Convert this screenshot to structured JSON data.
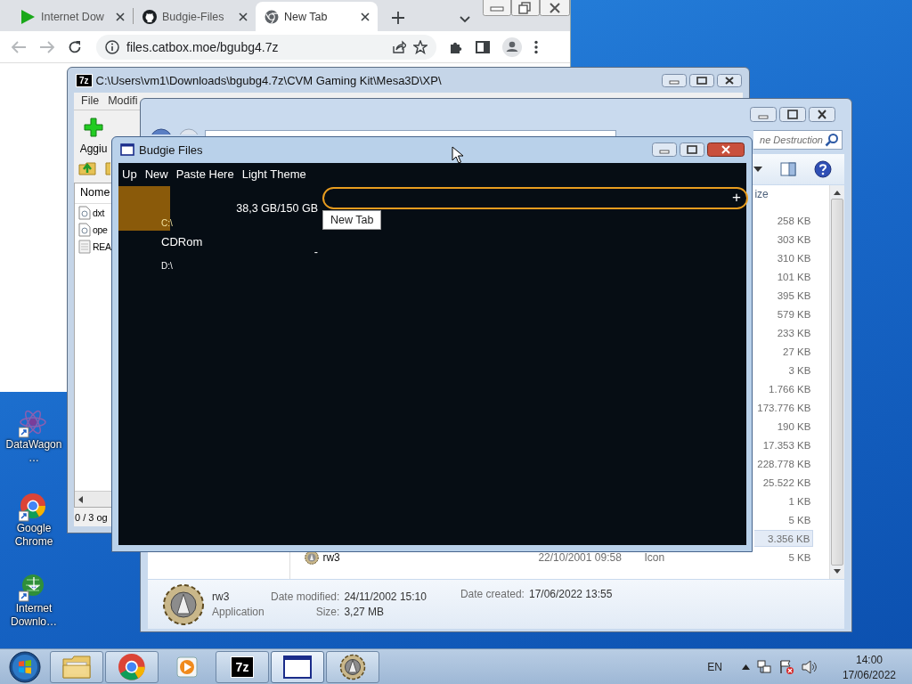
{
  "browser": {
    "tabs": [
      {
        "label": "Internet Dow",
        "kind": "download",
        "selected": false
      },
      {
        "label": "Budgie-Files",
        "kind": "github",
        "selected": false
      },
      {
        "label": "New Tab",
        "kind": "chrome",
        "selected": true
      }
    ],
    "url": "files.catbox.moe/bgubg4.7z"
  },
  "desktop_icons": [
    {
      "label": "DataWagon…",
      "kind": "atom"
    },
    {
      "label": "Google Chrome",
      "kind": "chrome"
    },
    {
      "label": "Internet Downlo…",
      "kind": "download"
    }
  ],
  "archive_window": {
    "logo": "7z",
    "title": "C:\\Users\\vm1\\Downloads\\bgubg4.7z\\CVM Gaming Kit\\Mesa3D\\XP\\",
    "menu": [
      "File",
      "Modifi"
    ],
    "add_label": "Aggiu",
    "column": "Nome",
    "files": [
      {
        "name": "dxt",
        "kind": "file"
      },
      {
        "name": "ope",
        "kind": "file"
      },
      {
        "name": "REA",
        "kind": "text"
      }
    ],
    "status": "0 / 3 og"
  },
  "explorer_window": {
    "search": {
      "placeholder": "ne Destruction"
    },
    "size_column": "ize",
    "rows": [
      {
        "size": "258 KB",
        "selected": false
      },
      {
        "size": "303 KB",
        "selected": false
      },
      {
        "size": "310 KB",
        "selected": false
      },
      {
        "size": "101 KB",
        "selected": false
      },
      {
        "size": "395 KB",
        "selected": false
      },
      {
        "size": "579 KB",
        "selected": false
      },
      {
        "size": "233 KB",
        "selected": false
      },
      {
        "size": "27 KB",
        "selected": false
      },
      {
        "size": "3 KB",
        "selected": false
      },
      {
        "size": "1.766 KB",
        "selected": false
      },
      {
        "size": "173.776 KB",
        "selected": false
      },
      {
        "size": "190 KB",
        "selected": false
      },
      {
        "size": "17.353 KB",
        "selected": false
      },
      {
        "size": "228.778 KB",
        "selected": false
      },
      {
        "size": "25.522 KB",
        "selected": false
      },
      {
        "size": "1 KB",
        "selected": false
      },
      {
        "size": "5 KB",
        "selected": false
      },
      {
        "size": "3.356 KB",
        "selected": true
      },
      {
        "name": "rw3",
        "date": "22/10/2001 09:58",
        "type": "Icon",
        "size": "5 KB",
        "kind": "gear",
        "selected": false
      }
    ],
    "details": {
      "name": "rw3",
      "type": "Application",
      "modified_label": "Date modified:",
      "modified": "24/11/2002 15:10",
      "size_label": "Size:",
      "size": "3,27 MB",
      "created_label": "Date created:",
      "created": "17/06/2022 13:55"
    }
  },
  "app_window": {
    "title": "Budgie Files",
    "menu": [
      "Up",
      "New",
      "Paste Here",
      "Light Theme"
    ],
    "drives": [
      {
        "path": "C:\\",
        "usage": "38,3 GB/150 GB",
        "selected": true
      },
      {
        "label": "CDRom",
        "path": "D:\\",
        "usage": "-",
        "selected": false
      }
    ],
    "new_tab": "+",
    "tooltip": "New Tab"
  },
  "taskbar": {
    "apps": [
      {
        "kind": "folder",
        "running": true,
        "active": false
      },
      {
        "kind": "chrome",
        "running": true,
        "active": false
      },
      {
        "kind": "media",
        "running": false,
        "active": false
      },
      {
        "kind": "sevenzip",
        "logo": "7z",
        "running": true,
        "active": false
      },
      {
        "kind": "window",
        "running": true,
        "active": true
      },
      {
        "kind": "gear",
        "running": true,
        "active": false
      }
    ],
    "language": "EN",
    "time": "14:00",
    "date": "17/06/2022"
  }
}
